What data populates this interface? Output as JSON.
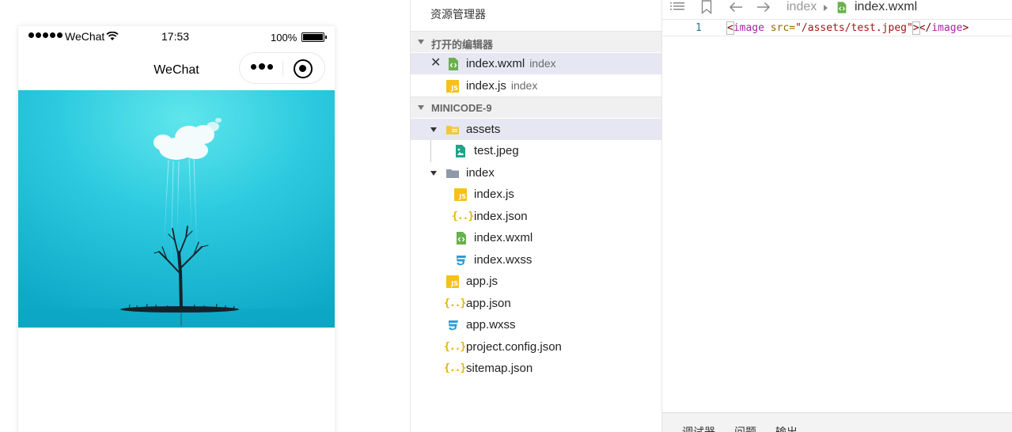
{
  "simulator": {
    "status_bar": {
      "carrier": "WeChat",
      "time": "17:53",
      "battery_pct": "100%"
    },
    "nav_title": "WeChat"
  },
  "explorer": {
    "title": "资源管理器",
    "open_editors": {
      "header": "打开的编辑器",
      "items": [
        {
          "name": "index.wxml",
          "desc": "index"
        },
        {
          "name": "index.js",
          "desc": "index"
        }
      ]
    },
    "project": {
      "header": "MINICODE-9",
      "tree": [
        {
          "name": "assets"
        },
        {
          "name": "test.jpeg"
        },
        {
          "name": "index"
        },
        {
          "name": "index.js"
        },
        {
          "name": "index.json"
        },
        {
          "name": "index.wxml"
        },
        {
          "name": "index.wxss"
        },
        {
          "name": "app.js"
        },
        {
          "name": "app.json"
        },
        {
          "name": "app.wxss"
        },
        {
          "name": "project.config.json"
        },
        {
          "name": "sitemap.json"
        }
      ]
    }
  },
  "editor": {
    "breadcrumb": {
      "folder": "index",
      "file": "index.wxml"
    },
    "code": {
      "line_number": "1",
      "open_bracket": "<",
      "tag": "image",
      "attr": " src=",
      "value": "\"/assets/test.jpeg\"",
      "close_bracket": ">",
      "close_tag_open": "</",
      "close_tag_name": "image",
      "close_tag_end": ">"
    },
    "bottom_tabs": [
      "调试器",
      "问题",
      "输出"
    ]
  },
  "colors": {
    "selected_row": "#e6e7f2",
    "section_bg": "#f0f0f0",
    "js_icon": "#f5c11a",
    "json_icon": "#e8b100",
    "wxml_icon": "#6ab04c",
    "wxss_icon": "#2d9cdb",
    "folder_yellow": "#f5c542",
    "folder_gray": "#8e9aa8",
    "image_icon": "#1fa38a",
    "sky": "#2cc7dc"
  }
}
